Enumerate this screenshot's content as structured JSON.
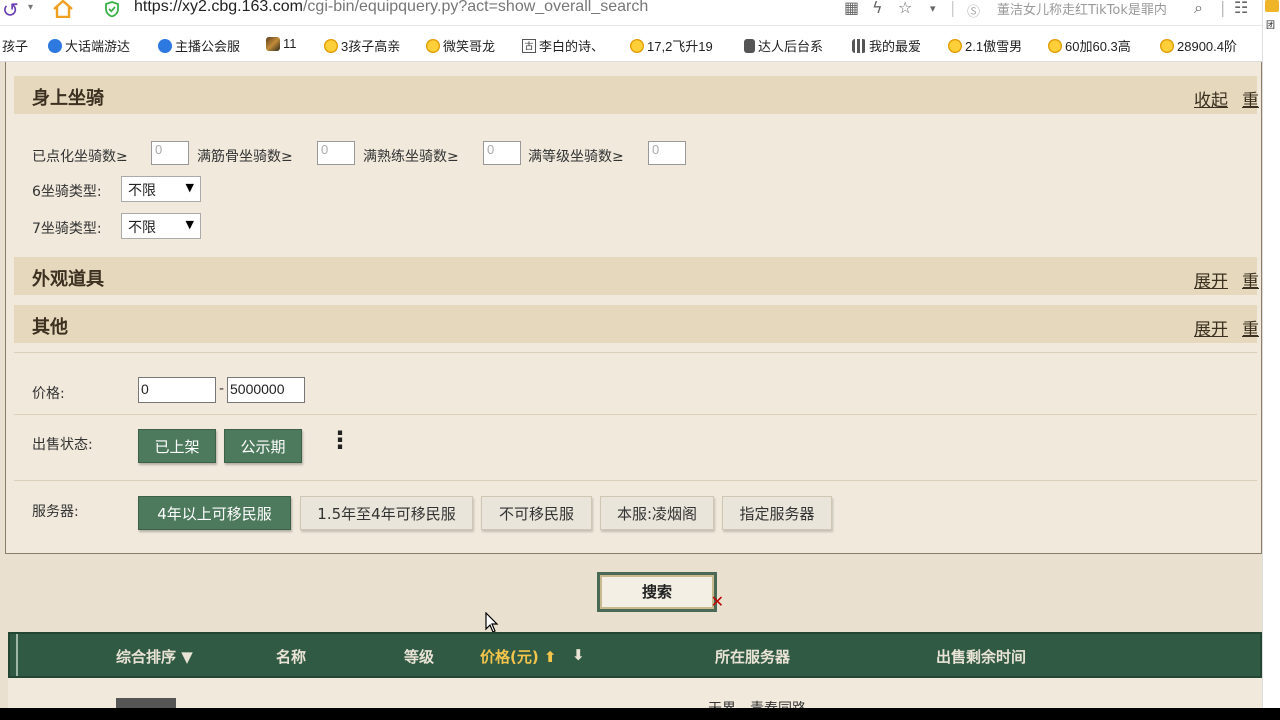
{
  "browser": {
    "url_host": "https://xy2.cbg.163.com",
    "url_path": "/cgi-bin/equipquery.py?act=show_overall_search",
    "search_suggest": "董洁女儿称走红TikTok是罪内",
    "right_panel_label": "团"
  },
  "bookmarks": [
    {
      "label": "孩子",
      "icon": "none"
    },
    {
      "label": "大话端游达",
      "icon": "blue-c-icon"
    },
    {
      "label": "主播公会服",
      "icon": "blue-c-icon"
    },
    {
      "label": "11",
      "icon": "picture-icon"
    },
    {
      "label": "3孩子高亲",
      "icon": "yellow-face-icon"
    },
    {
      "label": "微笑哥龙",
      "icon": "yellow-face-icon"
    },
    {
      "label": "李白的诗、",
      "icon": "gu-icon"
    },
    {
      "label": "17,2飞升19",
      "icon": "yellow-face-icon"
    },
    {
      "label": "达人后台系",
      "icon": "document-icon"
    },
    {
      "label": "我的最爱",
      "icon": "grid-icon"
    },
    {
      "label": "2.1傲雪男",
      "icon": "yellow-face-icon"
    },
    {
      "label": "60加60.3高",
      "icon": "yellow-face-icon"
    },
    {
      "label": "28900.4阶",
      "icon": "yellow-face-icon"
    }
  ],
  "mount_section": {
    "title": "身上坐骑",
    "toggle": "收起",
    "reset": "重",
    "filters": [
      {
        "label": "已点化坐骑数≥",
        "value": "0"
      },
      {
        "label": "满筋骨坐骑数≥",
        "value": "0"
      },
      {
        "label": "满熟练坐骑数≥",
        "value": "0"
      },
      {
        "label": "满等级坐骑数≥",
        "value": "0"
      }
    ],
    "type6_label": "6坐骑类型:",
    "type6_value": "不限",
    "type7_label": "7坐骑类型:",
    "type7_value": "不限"
  },
  "appearance_section": {
    "title": "外观道具",
    "toggle": "展开",
    "reset": "重"
  },
  "other_section": {
    "title": "其他",
    "toggle": "展开",
    "reset": "重"
  },
  "price": {
    "label": "价格:",
    "min": "0",
    "separator": "-",
    "max": "5000000"
  },
  "sale_status": {
    "label": "出售状态:",
    "options": [
      "已上架",
      "公示期"
    ]
  },
  "server": {
    "label": "服务器:",
    "options": [
      "4年以上可移民服",
      "1.5年至4年可移民服",
      "不可移民服",
      "本服:凌烟阁",
      "指定服务器"
    ]
  },
  "search_button": "搜索",
  "table": {
    "columns": [
      "综合排序 ▼",
      "名称",
      "等级",
      "价格(元) ⬆",
      "⬇",
      "所在服务器",
      "出售剩余时间"
    ],
    "first_row_server": "天界 - 青春同路"
  },
  "colors": {
    "accent_green": "#4d7a5d",
    "header_bg": "#e6d8bc",
    "table_head_bg": "#315a45",
    "active_sort": "#f3c54b"
  }
}
